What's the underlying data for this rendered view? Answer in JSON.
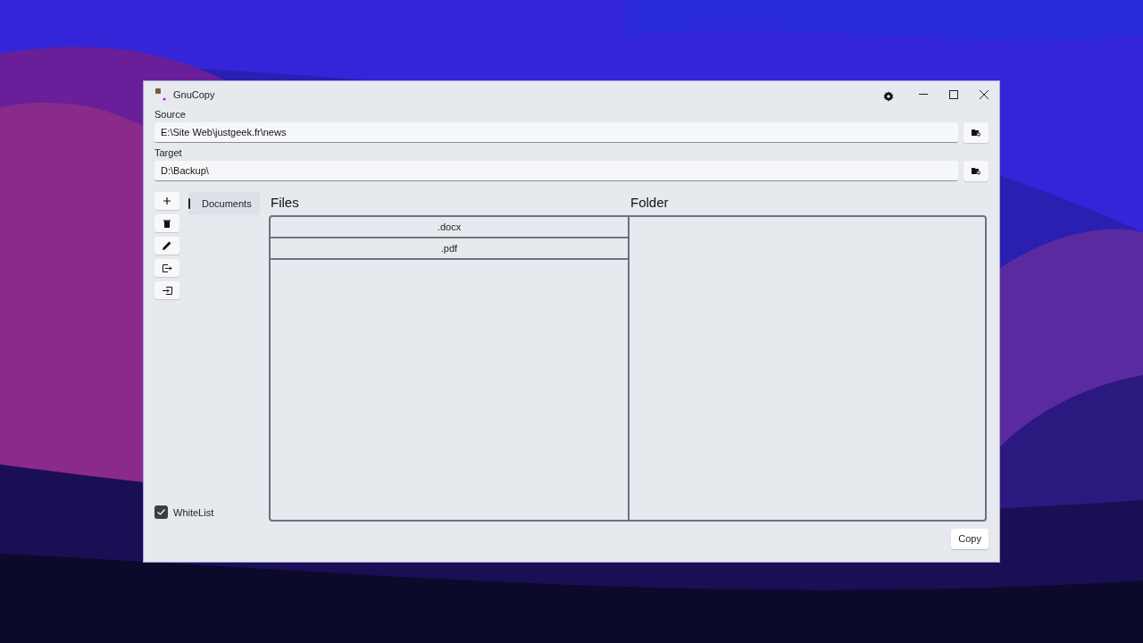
{
  "window": {
    "title": "GnuCopy"
  },
  "source": {
    "label": "Source",
    "value": "E:\\Site Web\\justgeek.fr\\news"
  },
  "target": {
    "label": "Target",
    "value": "D:\\Backup\\"
  },
  "tools": [
    {
      "kind": "add"
    },
    {
      "kind": "delete"
    },
    {
      "kind": "edit"
    },
    {
      "kind": "export"
    },
    {
      "kind": "import"
    }
  ],
  "profiles": [
    {
      "label": "Documents",
      "selected": true
    }
  ],
  "files": {
    "title": "Files",
    "items": [
      ".docx",
      ".pdf"
    ]
  },
  "folder": {
    "title": "Folder"
  },
  "whitelist": {
    "label": "WhiteList",
    "checked": true
  },
  "copy_button": "Copy"
}
